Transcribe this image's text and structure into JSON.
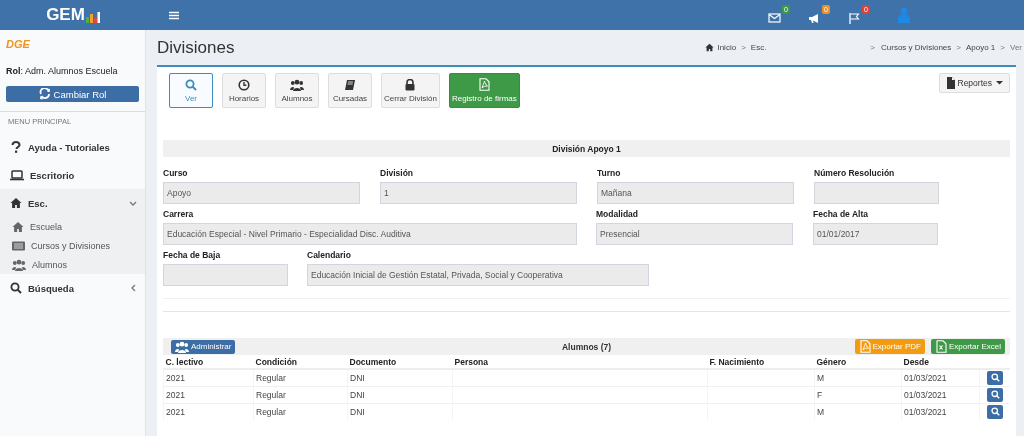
{
  "header": {
    "brand": "GEM",
    "badges": [
      {
        "count": "0",
        "color": "#3a9a4a"
      },
      {
        "count": "0",
        "color": "#e8922c"
      },
      {
        "count": "0",
        "color": "#d9443c"
      }
    ]
  },
  "sidebar": {
    "logo": "DGE",
    "role": "**Rol**: Adm. Alumnos Escuela",
    "role_button": "Cambiar Rol",
    "menu_header": "MENU PRINCIPAL",
    "items": [
      {
        "label": "Ayuda - Tutoriales"
      },
      {
        "label": "Escritorio"
      },
      {
        "label": "Esc.",
        "expanded": true,
        "children": [
          {
            "label": "Escuela"
          },
          {
            "label": "Cursos y Divisiones"
          },
          {
            "label": "Alumnos"
          }
        ]
      },
      {
        "label": "Búsqueda",
        "expanded": false
      }
    ]
  },
  "page": {
    "title": "Divisiones",
    "separator": ">",
    "breadcrumb": [
      {
        "label": "Inicio",
        "gap_before": false
      },
      {
        "label": "Esc.",
        "gap_before": false
      },
      {
        "label": "Cursos y Divisiones",
        "gap_before": true
      },
      {
        "label": "Apoyo 1",
        "gap_before": false
      },
      {
        "label": "Ver",
        "gap_before": false
      }
    ]
  },
  "toolbar": {
    "buttons": [
      {
        "label": "Ver",
        "kind": "default",
        "selected": true
      },
      {
        "label": "Horarios",
        "kind": "default",
        "selected": false
      },
      {
        "label": "Alumnos",
        "kind": "default",
        "selected": false
      },
      {
        "label": "Cursadas",
        "kind": "default",
        "selected": false
      },
      {
        "label": "Cerrar División",
        "kind": "default",
        "selected": false
      },
      {
        "label": "Registro de firmas",
        "kind": "success",
        "selected": false
      }
    ],
    "reports": "Reportes"
  },
  "section_title": "División Apoyo 1",
  "form": {
    "rows": [
      [
        {
          "label": "Curso",
          "value": "Apoyo",
          "kind": "normal"
        },
        {
          "label": "División",
          "value": "1",
          "kind": "normal"
        },
        {
          "label": "Turno",
          "value": "Mañana",
          "kind": "normal"
        },
        {
          "label": "Número Resolución",
          "kind": "short"
        }
      ],
      [
        {
          "label": "Carrera",
          "value": "Educación Especial - Nivel Primario - Especialidad Disc. Auditiva",
          "kind": "wide"
        },
        "",
        {
          "label": "Modalidad",
          "value": "Presencial",
          "kind": "normal"
        },
        {
          "label": "Fecha de Alta",
          "value": "01/01/2017",
          "kind": "short"
        }
      ],
      [
        {
          "label": "Fecha de Baja",
          "kind": "short"
        },
        {
          "label": "Calendario",
          "value": "Educación Inicial de Gestión Estatal, Privada, Social y Cooperativa",
          "kind": "medium"
        }
      ]
    ]
  },
  "students": {
    "title": "Alumnos (7)",
    "manage_button": "Administrar",
    "actions": [
      {
        "label": "Exportar PDF",
        "kind": "warning"
      },
      {
        "label": "Exportar Excel",
        "kind": "success"
      }
    ],
    "columns": [
      "C. lectivo",
      "Condición",
      "Documento",
      "Persona",
      "F. Nacimiento",
      "Género",
      "Desde"
    ],
    "rows": [
      [
        "2021",
        "Regular",
        "DNI",
        "",
        "",
        "M",
        "01/03/2021"
      ],
      [
        "2021",
        "Regular",
        "DNI",
        "",
        "",
        "F",
        "01/03/2021"
      ],
      [
        "2021",
        "Regular",
        "DNI",
        "",
        "",
        "M",
        "01/03/2021"
      ]
    ]
  }
}
